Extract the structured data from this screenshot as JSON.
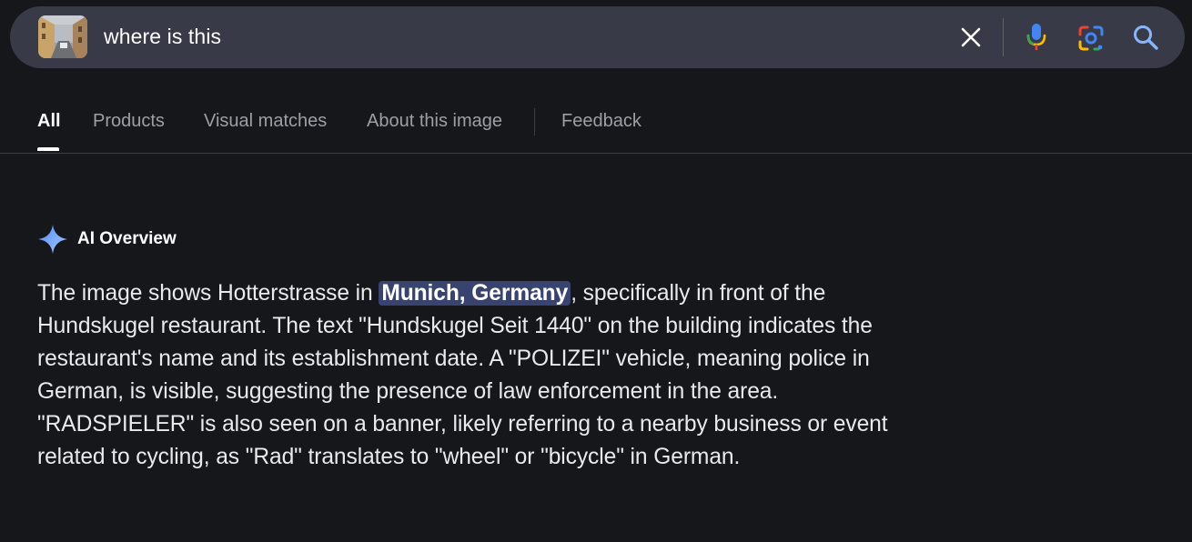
{
  "search": {
    "query": "where is this",
    "thumbnail_icon": "street-photo-thumbnail",
    "clear_icon": "close-icon",
    "voice_icon": "microphone-icon",
    "lens_icon": "camera-lens-icon",
    "search_icon": "search-icon"
  },
  "tabs": [
    {
      "label": "All",
      "active": true
    },
    {
      "label": "Products",
      "active": false
    },
    {
      "label": "Visual matches",
      "active": false
    },
    {
      "label": "About this image",
      "active": false
    },
    {
      "label": "Feedback",
      "active": false
    }
  ],
  "ai_overview": {
    "title": "AI Overview",
    "icon": "sparkle-icon",
    "text_before": "The image shows Hotterstrasse in ",
    "highlight": "Munich, Germany",
    "text_after": ", specifically in front of the Hundskugel restaurant. The text \"Hundskugel Seit 1440\" on the building indicates the restaurant's name and its establishment date. A \"POLIZEI\" vehicle, meaning police in German, is visible, suggesting the presence of law enforcement in the area. \"RADSPIELER\" is also seen on a banner, likely referring to a nearby business or event related to cycling, as \"Rad\" translates to \"wheel\" or \"bicycle\" in German."
  },
  "colors": {
    "background": "#16171b",
    "search_bar": "#383b47",
    "highlight": "#394370",
    "mic_blue": "#4285f4",
    "mic_red": "#ea4335",
    "search_icon_blue": "#8ab4f8"
  }
}
